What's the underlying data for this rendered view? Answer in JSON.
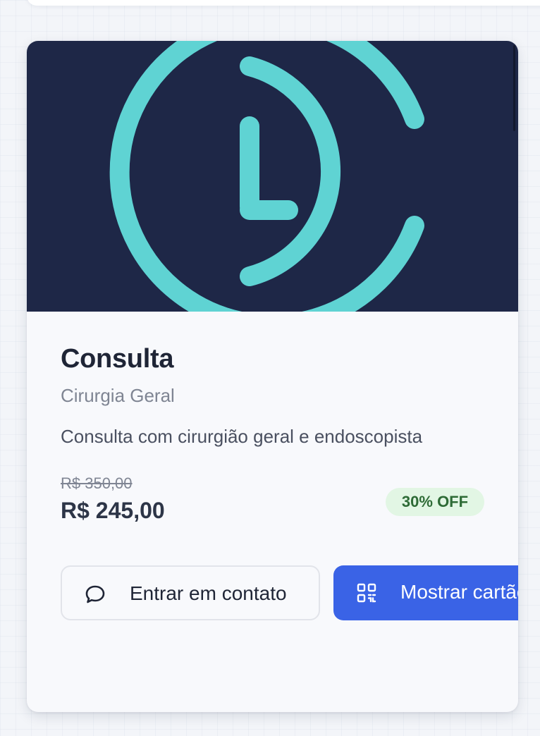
{
  "service": {
    "title": "Consulta",
    "specialty": "Cirurgia Geral",
    "description": "Consulta com cirurgião geral e endoscopista",
    "old_price": "R$ 350,00",
    "price": "R$ 245,00",
    "discount_badge": "30% OFF"
  },
  "actions": {
    "contact_label": "Entrar em contato",
    "contact_icon": "chat-bubble-icon",
    "show_card_label": "Mostrar cartão",
    "show_card_icon": "qr-code-icon"
  },
  "colors": {
    "banner_bg": "#1e2747",
    "logo_accent": "#5fd3d3",
    "primary_button": "#3a63e6",
    "badge_bg": "#e2f6e4",
    "badge_text": "#2e6b36"
  }
}
